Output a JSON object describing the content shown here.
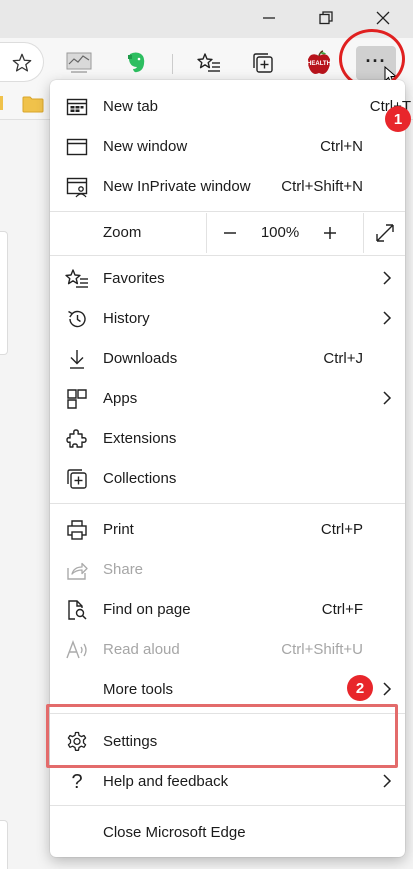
{
  "window": {
    "controls": [
      "minimize-icon",
      "restore-icon",
      "close-icon"
    ]
  },
  "toolbar": {
    "icons": [
      "favorite-star-icon",
      "extension-graph-icon",
      "evernote-icon",
      "favorites-list-icon",
      "collections-icon",
      "health-apple-icon",
      "more-options-icon"
    ],
    "more_label": "···",
    "health_text": "HEALTH"
  },
  "menu": {
    "new_tab": {
      "label": "New tab",
      "shortcut": "Ctrl+T"
    },
    "new_window": {
      "label": "New window",
      "shortcut": "Ctrl+N"
    },
    "new_inprivate": {
      "label": "New InPrivate window",
      "shortcut": "Ctrl+Shift+N"
    },
    "zoom": {
      "label": "Zoom",
      "value": "100%",
      "minus": "—",
      "plus": "+"
    },
    "favorites": {
      "label": "Favorites"
    },
    "history": {
      "label": "History"
    },
    "downloads": {
      "label": "Downloads",
      "shortcut": "Ctrl+J"
    },
    "apps": {
      "label": "Apps"
    },
    "extensions": {
      "label": "Extensions"
    },
    "collections": {
      "label": "Collections"
    },
    "print": {
      "label": "Print",
      "shortcut": "Ctrl+P"
    },
    "share": {
      "label": "Share"
    },
    "find_on_page": {
      "label": "Find on page",
      "shortcut": "Ctrl+F"
    },
    "read_aloud": {
      "label": "Read aloud",
      "shortcut": "Ctrl+Shift+U"
    },
    "more_tools": {
      "label": "More tools"
    },
    "settings": {
      "label": "Settings"
    },
    "help_feedback": {
      "label": "Help and feedback"
    },
    "close_edge": {
      "label": "Close Microsoft Edge"
    }
  },
  "annotations": {
    "badge1": "1",
    "badge2": "2",
    "accent": "#e8262b"
  }
}
